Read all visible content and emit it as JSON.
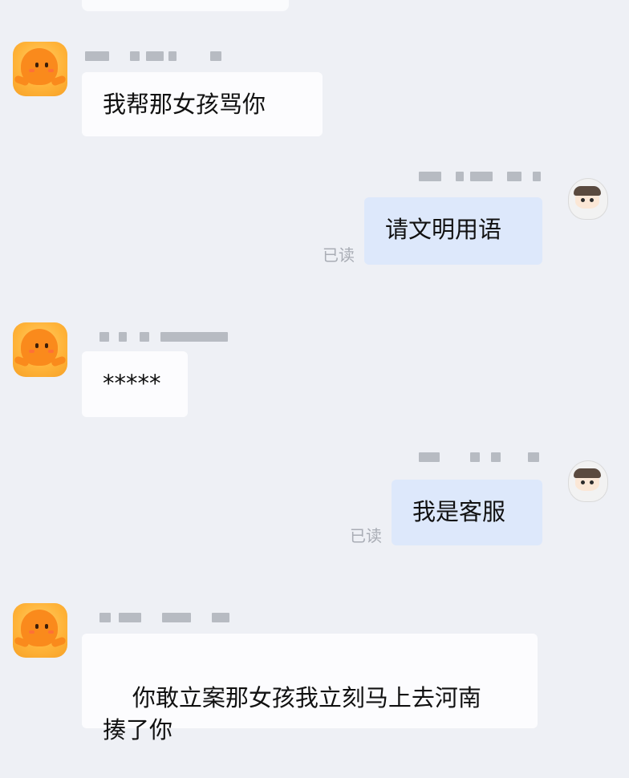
{
  "messages": [
    {
      "side": "left",
      "text": "我帮那女孩骂你"
    },
    {
      "side": "right",
      "text": "请文明用语",
      "status": "已读"
    },
    {
      "side": "left",
      "text": "*****"
    },
    {
      "side": "right",
      "text": "我是客服",
      "status": "已读"
    },
    {
      "side": "left",
      "text": "你敢立案那女孩我立刻马上去河南\n揍了你"
    }
  ],
  "icons": {
    "left_avatar": "orange-octopus-avatar-icon",
    "right_avatar": "hooded-character-avatar-icon"
  },
  "colors": {
    "background": "#eef0f5",
    "incoming_bubble": "#fcfcfe",
    "outgoing_bubble": "#dde8fb",
    "read_status": "#a9adb5"
  }
}
